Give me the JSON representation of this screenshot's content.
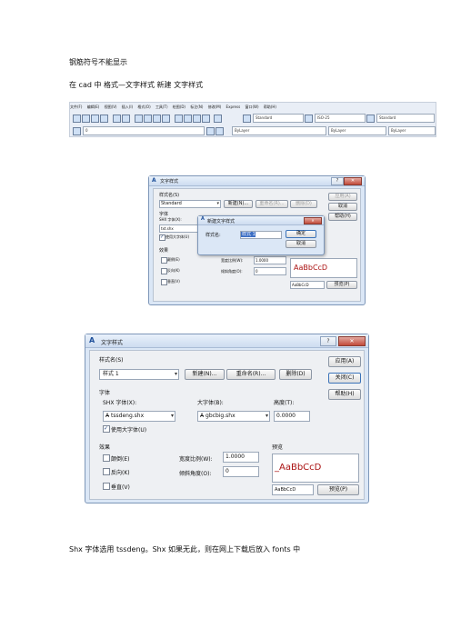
{
  "doc": {
    "heading": "钢筋符号不能显示",
    "instruction": "在 cad 中   格式—文字样式     新建 文字样式",
    "footer": "Shx 字体选用   tssdeng。Shx    如果无此，则在网上下载后放入    fonts 中"
  },
  "cad_toolbar": {
    "menu": [
      "文件(F)",
      "编辑(E)",
      "视图(V)",
      "插入(I)",
      "格式(O)",
      "工具(T)",
      "绘图(D)",
      "标注(N)",
      "修改(M)",
      "Express",
      "窗口(W)",
      "帮助(H)"
    ],
    "text_style_combo": "Standard",
    "dim_style_combo": "ISO-25",
    "table_style_combo": "Standard",
    "layer_combo": "0",
    "color_combo": "ByLayer",
    "linetype_combo": "ByLayer",
    "lineweight_combo": "ByLayer"
  },
  "small_dialog": {
    "title": "文字样式",
    "style_name_label": "样式名(S)",
    "style_value": "Standard",
    "new_btn": "新建(N)...",
    "rename_btn": "重命名(R)...",
    "delete_btn": "删除(D)",
    "apply_btn": "应用(A)",
    "cancel_btn": "取消",
    "help_btn": "帮助(H)",
    "font_group": "字体",
    "shx_label": "SHX 字体(X):",
    "shx_value": "txt.shx",
    "bigfont_check": "使用大字体(U)",
    "effects_group": "效果",
    "upside": "颠倒(E)",
    "backwards": "反向(K)",
    "vertical": "垂直(V)",
    "width_label": "宽度比例(W):",
    "width_value": "1.0000",
    "oblique_label": "倾斜角度(O):",
    "oblique_value": "0",
    "preview_text": "AaBbCcD",
    "preview_field": "AaBbCcD",
    "preview_btn": "预览(P)",
    "new_style": {
      "title": "新建文字样式",
      "name_label": "样式名:",
      "name_value": "样式 1",
      "ok_btn": "确定",
      "cancel_btn": "取消"
    }
  },
  "large_dialog": {
    "title": "文字样式",
    "style_name_label": "样式名(S)",
    "style_value": "样式 1",
    "new_btn": "新建(N)...",
    "rename_btn": "重命名(R)...",
    "delete_btn": "删除(D)",
    "apply_btn": "应用(A)",
    "close_btn": "关闭(C)",
    "help_btn": "帮助(H)",
    "font_group": "字体",
    "shx_label": "SHX 字体(X):",
    "shx_value": "tssdeng.shx",
    "bigfont_label": "大字体(B):",
    "bigfont_value": "gbcbig.shx",
    "height_label": "高度(T):",
    "height_value": "0.0000",
    "bigfont_check": "使用大字体(U)",
    "effects_group": "效果",
    "upside": "颠倒(E)",
    "backwards": "反向(K)",
    "vertical": "垂直(V)",
    "width_label": "宽度比例(W):",
    "width_value": "1.0000",
    "oblique_label": "倾斜角度(O):",
    "oblique_value": "0",
    "preview_group": "预览",
    "preview_text": "_AaBbCcD",
    "preview_field": "AaBbCcD",
    "preview_btn": "预览(P)"
  }
}
